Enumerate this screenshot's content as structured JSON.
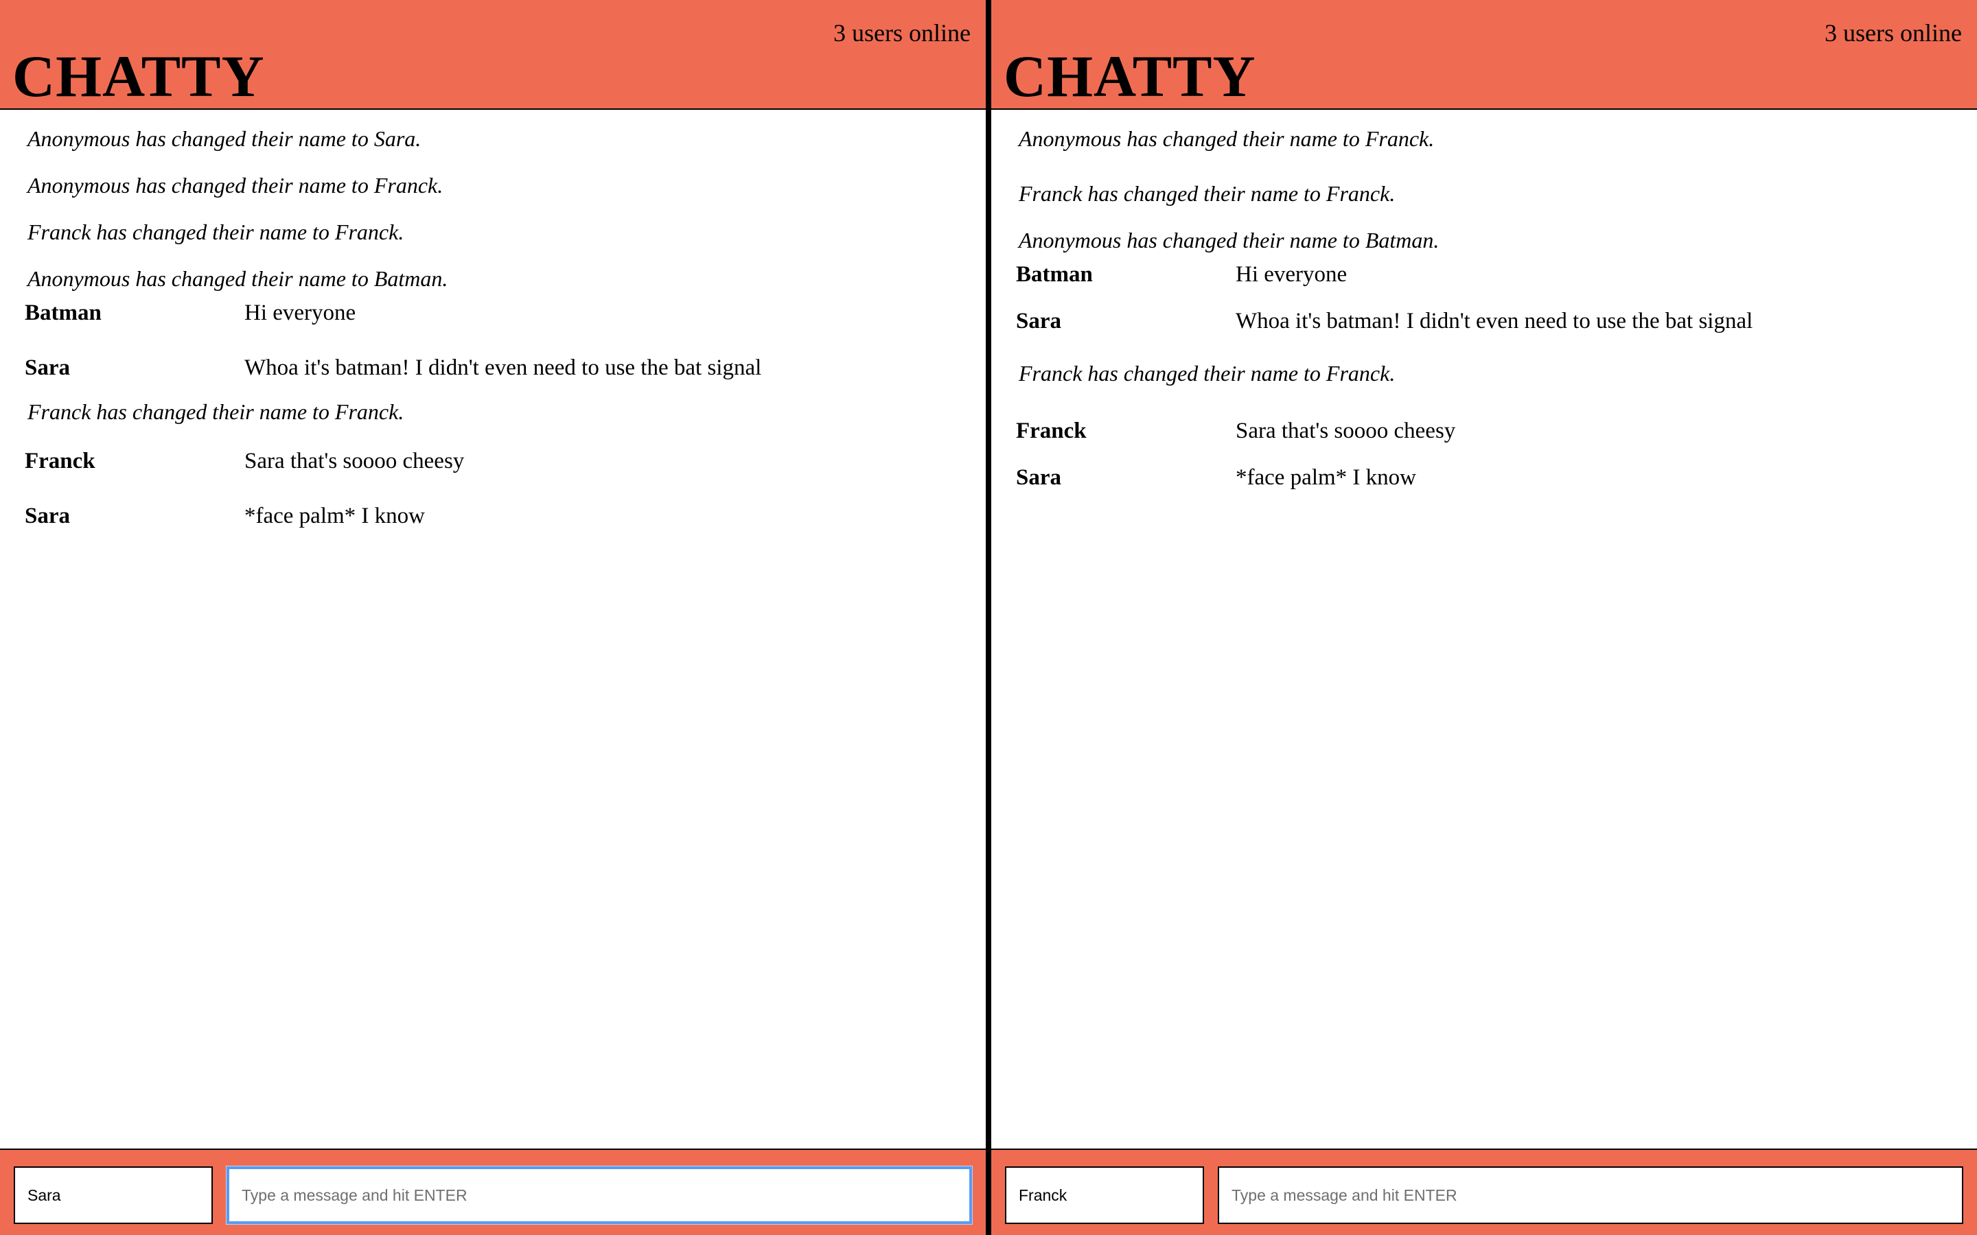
{
  "left": {
    "brand": "CHATTY",
    "user_count": "3 users online",
    "messages": [
      {
        "type": "system",
        "text": "Anonymous has changed their name to Sara."
      },
      {
        "type": "system",
        "text": "Anonymous has changed their name to Franck."
      },
      {
        "type": "system",
        "text": "Franck has changed their name to Franck."
      },
      {
        "type": "system",
        "text": "Anonymous has changed their name to Batman."
      },
      {
        "type": "message",
        "user": "Batman",
        "content": "Hi everyone"
      },
      {
        "type": "message",
        "user": "Sara",
        "content": "Whoa it's batman! I didn't even need to use the bat signal"
      },
      {
        "type": "system",
        "text": "Franck has changed their name to Franck."
      },
      {
        "type": "message",
        "user": "Franck",
        "content": "Sara that's soooo cheesy"
      },
      {
        "type": "message",
        "user": "Sara",
        "content": "*face palm* I know"
      }
    ],
    "username_value": "Sara",
    "message_placeholder": "Type a message and hit ENTER"
  },
  "right": {
    "brand": "CHATTY",
    "user_count": "3 users online",
    "messages": [
      {
        "type": "system",
        "text": "Anonymous has changed their name to Franck."
      },
      {
        "type": "system",
        "text": "Franck has changed their name to Franck."
      },
      {
        "type": "system",
        "text": "Anonymous has changed their name to Batman."
      },
      {
        "type": "message",
        "user": "Batman",
        "content": "Hi everyone"
      },
      {
        "type": "message",
        "user": "Sara",
        "content": "Whoa it's batman! I didn't even need to use the bat signal"
      },
      {
        "type": "system",
        "text": "Franck has changed their name to Franck."
      },
      {
        "type": "message",
        "user": "Franck",
        "content": "Sara that's soooo cheesy"
      },
      {
        "type": "message",
        "user": "Sara",
        "content": "*face palm* I know"
      }
    ],
    "username_value": "Franck",
    "message_placeholder": "Type a message and hit ENTER"
  },
  "colors": {
    "header_bg": "#ef6c53",
    "focus_ring": "#5b9bf0"
  }
}
